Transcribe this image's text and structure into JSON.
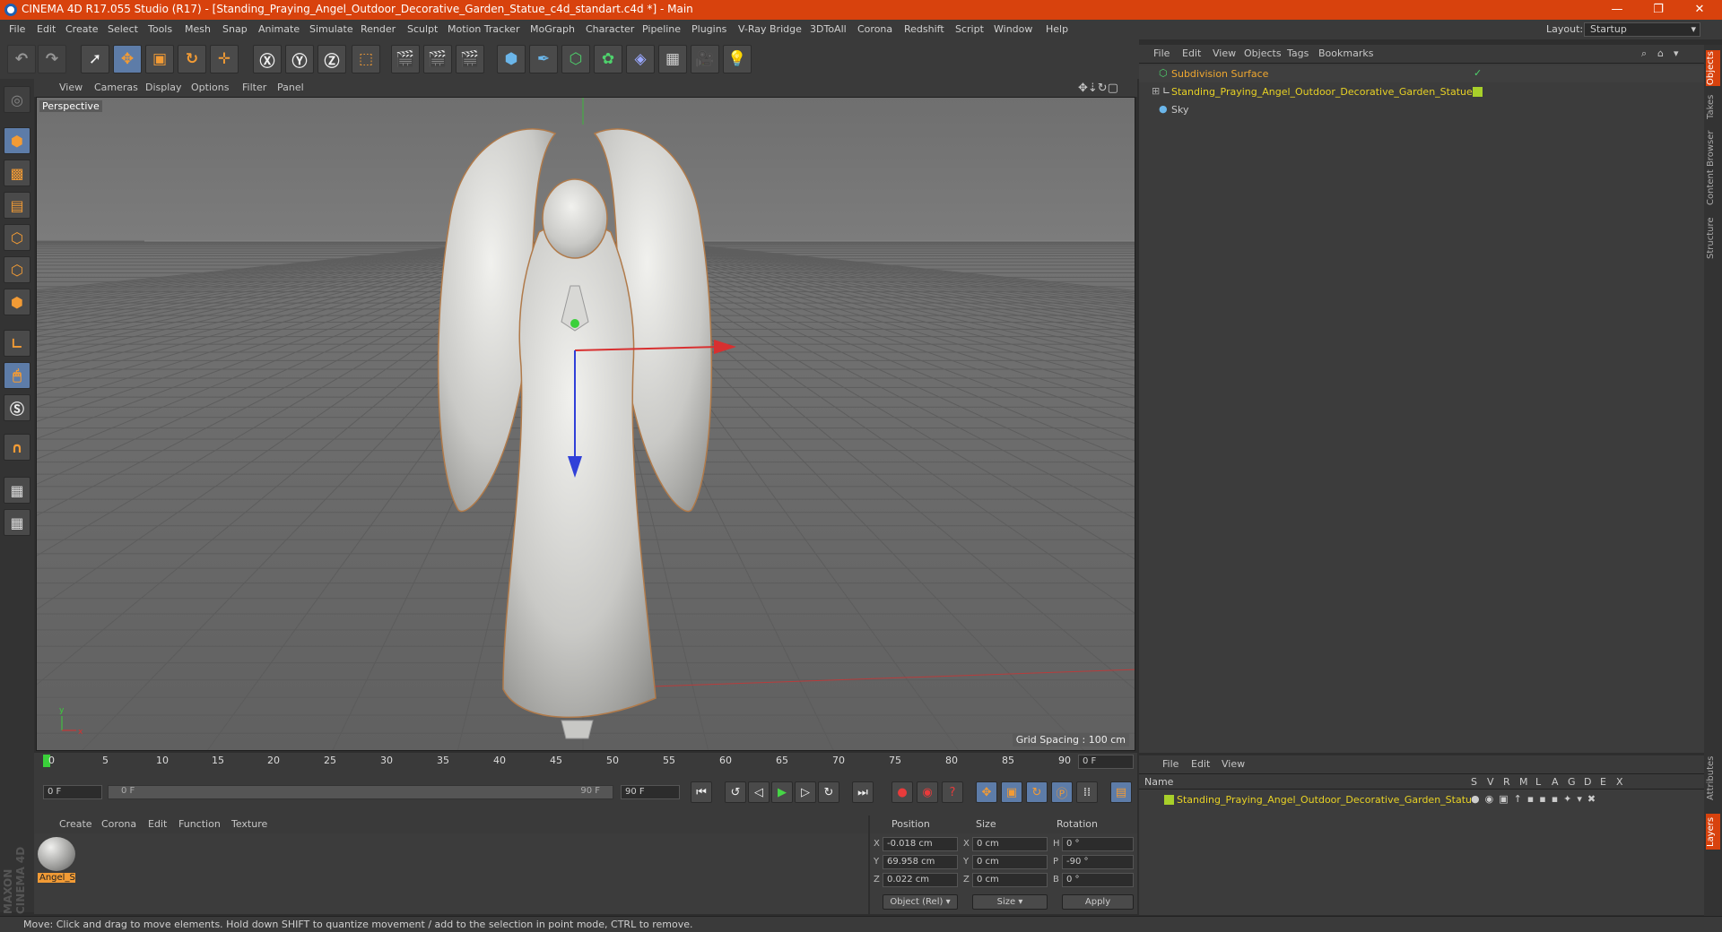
{
  "window": {
    "title": "CINEMA 4D R17.055 Studio (R17) - [Standing_Praying_Angel_Outdoor_Decorative_Garden_Statue_c4d_standart.c4d *] - Main",
    "minimize": "—",
    "maximize": "❐",
    "close": "✕"
  },
  "menubar": {
    "items": [
      "File",
      "Edit",
      "Create",
      "Select",
      "Tools",
      "Mesh",
      "Snap",
      "Animate",
      "Simulate",
      "Render",
      "Sculpt",
      "Motion Tracker",
      "MoGraph",
      "Character",
      "Pipeline",
      "Plugins",
      "V-Ray Bridge",
      "3DToAll",
      "Corona",
      "Redshift",
      "Script",
      "Window",
      "Help"
    ],
    "layout_label": "Layout:",
    "layout_value": "Startup"
  },
  "viewport": {
    "menu": [
      "View",
      "Cameras",
      "Display",
      "Options",
      "Filter",
      "Panel"
    ],
    "label": "Perspective",
    "grid_spacing": "Grid Spacing : 100 cm",
    "axis_y": "y",
    "axis_x": "x"
  },
  "objects_panel": {
    "menu": [
      "File",
      "Edit",
      "View",
      "Objects",
      "Tags",
      "Bookmarks"
    ],
    "items": [
      {
        "name": "Subdivision Surface",
        "color": "#f0a830"
      },
      {
        "name": "Standing_Praying_Angel_Outdoor_Decorative_Garden_Statue",
        "color": "#e8d225"
      },
      {
        "name": "Sky",
        "color": "#c8c8c8"
      }
    ]
  },
  "side_tabs": [
    "Objects",
    "Takes",
    "Content Browser",
    "Structure",
    "Attributes",
    "Layers"
  ],
  "layers_panel": {
    "menu": [
      "File",
      "Edit",
      "View"
    ],
    "header_name": "Name",
    "header_cols": [
      "S",
      "V",
      "R",
      "M",
      "L",
      "A",
      "G",
      "D",
      "E",
      "X"
    ],
    "items": [
      {
        "name": "Standing_Praying_Angel_Outdoor_Decorative_Garden_Statue",
        "color": "#e8d225"
      }
    ]
  },
  "timeline": {
    "ticks": [
      "0",
      "5",
      "10",
      "15",
      "20",
      "25",
      "30",
      "35",
      "40",
      "45",
      "50",
      "55",
      "60",
      "65",
      "70",
      "75",
      "80",
      "85",
      "90"
    ],
    "current_frame": "0 F",
    "start_frame": "0 F",
    "range_start": "0 F",
    "range_end": "90 F",
    "end_frame": "90 F"
  },
  "material_panel": {
    "menu": [
      "Create",
      "Corona",
      "Edit",
      "Function",
      "Texture"
    ],
    "materials": [
      {
        "name": "Angel_S"
      }
    ]
  },
  "coordinates": {
    "headers": {
      "position": "Position",
      "size": "Size",
      "rotation": "Rotation"
    },
    "rows": [
      {
        "axis": "X",
        "pos": "-0.018 cm",
        "size_axis": "X",
        "size": "0 cm",
        "rot_axis": "H",
        "rot": "0 °"
      },
      {
        "axis": "Y",
        "pos": "69.958 cm",
        "size_axis": "Y",
        "size": "0 cm",
        "rot_axis": "P",
        "rot": "-90 °"
      },
      {
        "axis": "Z",
        "pos": "0.022 cm",
        "size_axis": "Z",
        "size": "0 cm",
        "rot_axis": "B",
        "rot": "0 °"
      }
    ],
    "mode": "Object (Rel)",
    "size_mode": "Size",
    "apply": "Apply"
  },
  "statusbar": {
    "text": "Move: Click and drag to move elements. Hold down SHIFT to quantize movement / add to the selection in point mode, CTRL to remove."
  },
  "brand": "MAXON CINEMA 4D"
}
